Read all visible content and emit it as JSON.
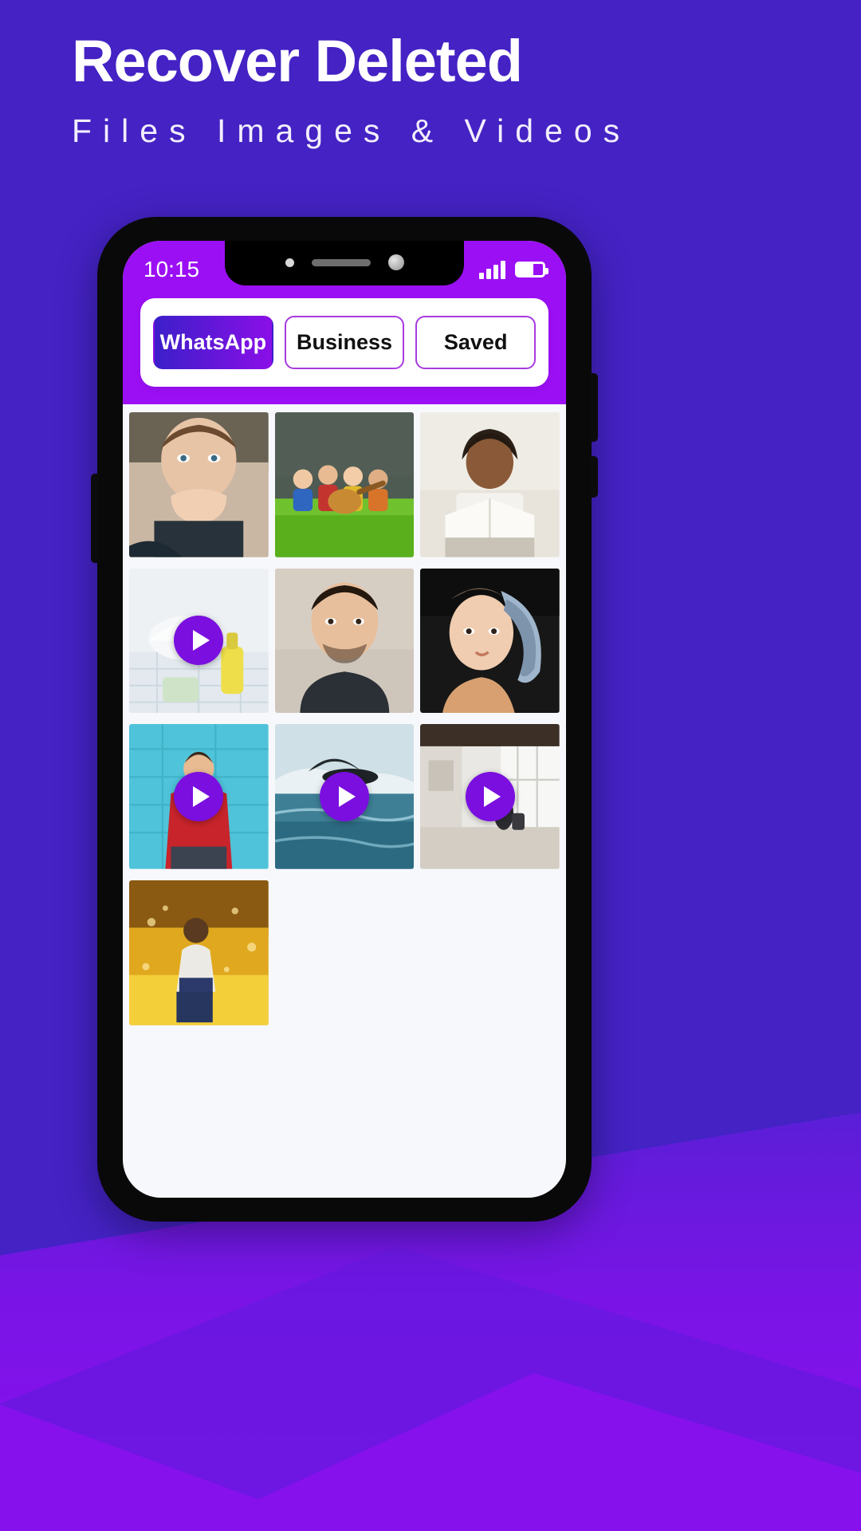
{
  "promo": {
    "headline": "Recover Deleted",
    "subheadline": "Files Images & Videos",
    "bg_color": "#4422c4",
    "accent_color": "#9b0ff5"
  },
  "phone": {
    "statusbar": {
      "time": "10:15",
      "signal_icon": "signal-bars-icon",
      "battery_icon": "battery-icon",
      "battery_level_percent": 62,
      "notch": {
        "camera_icon": "front-camera-icon",
        "speaker_icon": "earpiece-speaker-icon",
        "sensor_icon": "proximity-sensor-icon"
      }
    },
    "tabs": [
      {
        "label": "WhatsApp",
        "active": true
      },
      {
        "label": "Business",
        "active": false
      },
      {
        "label": "Saved",
        "active": false
      }
    ],
    "grid": {
      "play_icon": "play-icon",
      "rows": [
        [
          {
            "name": "young-man-hands-clasped",
            "type": "image",
            "is_video": false
          },
          {
            "name": "kids-with-guitar-on-grass",
            "type": "image",
            "is_video": false
          },
          {
            "name": "person-reading-book",
            "type": "image",
            "is_video": false
          }
        ],
        [
          {
            "name": "cap-and-juice-bottle",
            "type": "video",
            "is_video": true
          },
          {
            "name": "man-portrait-dark-shirt",
            "type": "image",
            "is_video": false
          },
          {
            "name": "woman-with-blue-hair",
            "type": "image",
            "is_video": false
          }
        ],
        [
          {
            "name": "man-red-sweater-blue-wall",
            "type": "video",
            "is_video": true
          },
          {
            "name": "iceberg-in-ocean",
            "type": "video",
            "is_video": true
          },
          {
            "name": "bright-hallway-interior",
            "type": "video",
            "is_video": true
          }
        ],
        [
          {
            "name": "boy-in-golden-water-spray",
            "type": "image",
            "is_video": false
          }
        ]
      ]
    }
  }
}
